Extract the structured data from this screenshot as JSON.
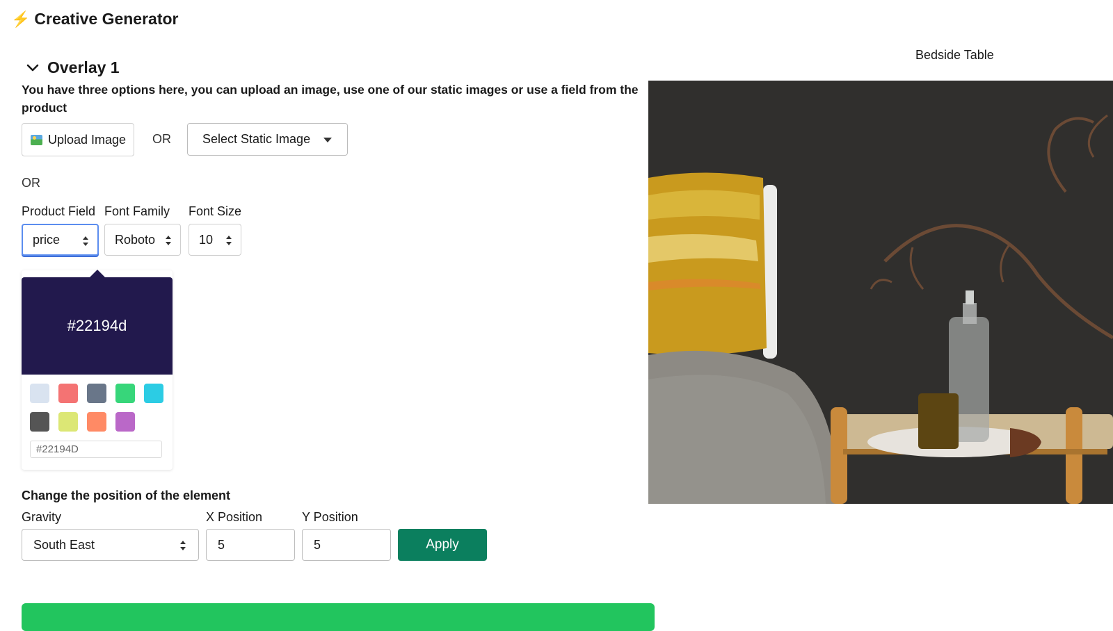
{
  "app": {
    "icon": "lightning-icon",
    "title": "Creative Generator"
  },
  "overlay": {
    "title": "Overlay 1",
    "instructions": "You have three options here, you can upload an image, use one of our static images or use a field from the product",
    "upload_label": "Upload Image",
    "or_label": "OR",
    "static_select_label": "Select Static Image",
    "or_label_2": "OR",
    "fields": {
      "product_field_label": "Product Field",
      "product_field_value": "price",
      "font_family_label": "Font Family",
      "font_family_value": "Roboto",
      "font_size_label": "Font Size",
      "font_size_value": "10"
    },
    "color_picker": {
      "current_hex_display": "#22194d",
      "current_color": "#22194d",
      "hex_input_value": "#22194D",
      "swatches": [
        "#d9e3f0",
        "#f47373",
        "#697689",
        "#37d67a",
        "#2ccce4",
        "#555555",
        "#dce775",
        "#ff8a65",
        "#ba68c8"
      ]
    },
    "position": {
      "heading": "Change the position of the element",
      "gravity_label": "Gravity",
      "gravity_value": "South East",
      "x_label": "X Position",
      "x_value": "5",
      "y_label": "Y Position",
      "y_value": "5",
      "apply_label": "Apply"
    }
  },
  "preview": {
    "product_name": "Bedside Table"
  },
  "colors": {
    "accent": "#0b7f5e",
    "bar": "#22c55e",
    "focus": "#5b8def"
  }
}
